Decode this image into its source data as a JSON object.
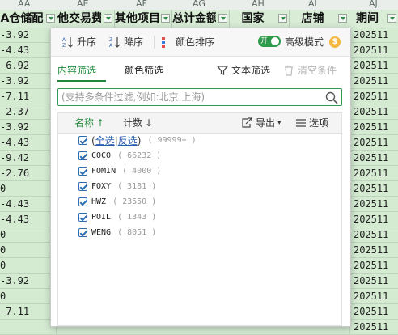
{
  "sheet": {
    "col_letters": [
      "AA",
      "AE",
      "AF",
      "AG",
      "AH",
      "AI",
      "AJ"
    ],
    "headers": [
      "A仓储配",
      "他交易费",
      "其他项目",
      "总计金额",
      "国家",
      "店铺",
      "期间"
    ],
    "col_a_values": [
      "-3.92",
      "-4.43",
      "-6.92",
      "-3.92",
      "-7.11",
      "-2.37",
      "-3.92",
      "-4.43",
      "-9.42",
      "-2.76",
      "0",
      "-4.43",
      "-4.43",
      "0",
      "0",
      "0",
      "-3.92",
      "0",
      "-7.11",
      ""
    ],
    "col_j_values": [
      "202511",
      "202511",
      "202511",
      "202511",
      "202511",
      "202511",
      "202511",
      "202511",
      "202511",
      "202511",
      "202511",
      "202511",
      "202511",
      "202511",
      "202511",
      "202511",
      "202511",
      "202511",
      "202511",
      "202511"
    ]
  },
  "popup": {
    "toolbar": {
      "sort_asc": "升序",
      "sort_desc": "降序",
      "color_sort": "颜色排序",
      "toggle_label": "开",
      "advanced_mode": "高级模式",
      "coin_symbol": "$"
    },
    "tabs": {
      "content_filter": "内容筛选",
      "color_filter": "颜色筛选",
      "text_filter": "文本筛选",
      "clear_conditions": "清空条件"
    },
    "search": {
      "placeholder": "(支持多条件过滤,例如:北京 上海)"
    },
    "list_header": {
      "name": "名称",
      "count": "计数",
      "export": "导出",
      "options": "选项"
    },
    "select_all": "全选",
    "invert": "反选",
    "select_all_count": "( 99999+ )",
    "items": [
      {
        "name": "COCO",
        "count": "( 66232 )"
      },
      {
        "name": "FOMIN",
        "count": "( 4000 )"
      },
      {
        "name": "FOXY",
        "count": "( 3181 )"
      },
      {
        "name": "HWZ",
        "count": "( 23550 )"
      },
      {
        "name": "POIL",
        "count": "( 1343 )"
      },
      {
        "name": "WENG",
        "count": "( 8051 )"
      }
    ]
  },
  "colors": {
    "accent_green": "#1f8a3d",
    "toggle_green": "#2e9b4c",
    "link_blue": "#2a5db0",
    "sheet_fill": "#d4ebd2"
  }
}
